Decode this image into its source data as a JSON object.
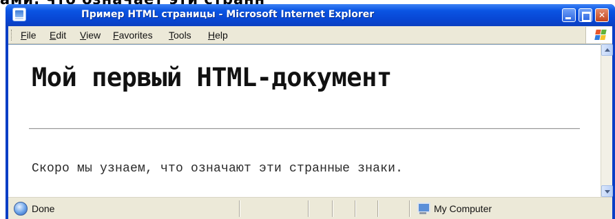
{
  "caption": "ами: что означает эти странн",
  "window": {
    "title": "Пример HTML страницы - Microsoft Internet Explorer",
    "menu": [
      "File",
      "Edit",
      "View",
      "Favorites",
      "Tools",
      "Help"
    ],
    "buttons": {
      "minimize": "",
      "maximize": "",
      "close": "✕"
    }
  },
  "document": {
    "heading": "Мой первый HTML-документ",
    "paragraph": "Скоро мы узнаем, что означают эти странные знаки."
  },
  "status": {
    "text": "Done",
    "zone": "My Computer"
  },
  "icons": {
    "app": "ie-page-icon",
    "logo": "windows-logo-icon",
    "status": "ie-globe-icon",
    "zone": "my-computer-icon"
  }
}
